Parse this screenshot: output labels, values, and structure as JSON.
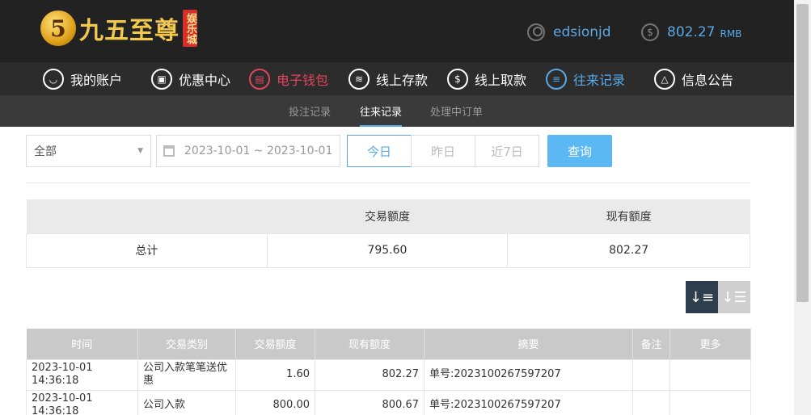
{
  "header": {
    "brand": "九五至尊",
    "brand_tag": "娱乐城",
    "username": "edsionjd",
    "balance": "802.27",
    "currency": "RMB"
  },
  "nav": {
    "items": [
      {
        "label": "我的账户",
        "icon": "user-icon"
      },
      {
        "label": "优惠中心",
        "icon": "gift-icon"
      },
      {
        "label": "电子钱包",
        "icon": "wallet-icon"
      },
      {
        "label": "线上存款",
        "icon": "deposit-icon"
      },
      {
        "label": "线上取款",
        "icon": "withdraw-icon"
      },
      {
        "label": "往来记录",
        "icon": "records-icon"
      },
      {
        "label": "信息公告",
        "icon": "bell-icon"
      }
    ],
    "active": "往来记录"
  },
  "subnav": {
    "items": [
      "投注记录",
      "往来记录",
      "处理中订单"
    ],
    "active": "往来记录"
  },
  "filters": {
    "type_select": "全部",
    "date_range": "2023-10-01 ~ 2023-10-01",
    "quick": [
      "今日",
      "昨日",
      "近7日"
    ],
    "quick_active": "今日",
    "query_label": "查询"
  },
  "summary": {
    "headers": [
      "",
      "交易额度",
      "现有额度"
    ],
    "row": [
      "总计",
      "795.60",
      "802.27"
    ]
  },
  "records": {
    "headers": [
      "时间",
      "交易类别",
      "交易额度",
      "现有额度",
      "摘要",
      "备注",
      "更多"
    ],
    "rows": [
      [
        "2023-10-01 14:36:18",
        "公司入款笔笔送优惠",
        "1.60",
        "802.27",
        "单号:2023100267597207",
        "",
        ""
      ],
      [
        "2023-10-01 14:36:18",
        "公司入款",
        "800.00",
        "800.67",
        "单号:2023100267597207",
        "",
        ""
      ]
    ]
  },
  "colors": {
    "accent": "#5aa9e6",
    "wallet": "#e0455e",
    "header_bg": "#222222",
    "sort_active": "#2f3e4e"
  }
}
